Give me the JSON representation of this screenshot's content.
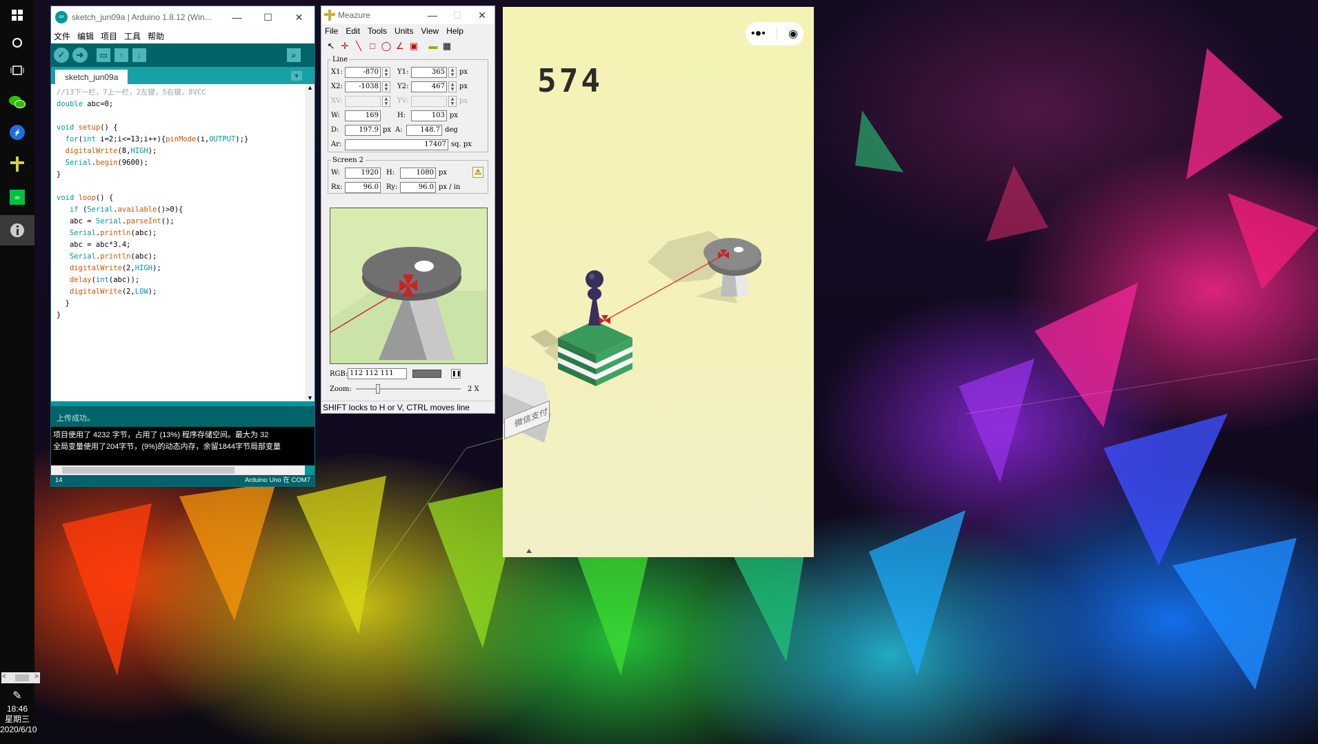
{
  "taskbar": {
    "start_icon": "windows-logo-icon",
    "items": [
      {
        "name": "cortana-icon"
      },
      {
        "name": "task-view-icon"
      },
      {
        "name": "wechat-icon"
      },
      {
        "name": "feishu-icon"
      },
      {
        "name": "meazure-icon"
      },
      {
        "name": "arduino-icon"
      },
      {
        "name": "info-icon"
      }
    ],
    "pen_icon": "pen-icon",
    "time": "18:46",
    "weekday": "星期三",
    "date": "2020/6/10"
  },
  "arduino": {
    "title": "sketch_jun09a | Arduino 1.8.12 (Win...",
    "menu": [
      "文件",
      "编辑",
      "项目",
      "工具",
      "帮助"
    ],
    "tab": "sketch_jun09a",
    "code": [
      "//13下一栏，7上一栏，2左键，5右键，8VCC",
      "double abc=0;",
      "",
      "void setup() {",
      "  for(int i=2;i<=13;i++){pinMode(i,OUTPUT);}",
      "  digitalWrite(8,HIGH);",
      "  Serial.begin(9600);",
      "}",
      "",
      "void loop() {",
      "   if (Serial.available()>0){",
      "   abc = Serial.parseInt();",
      "   Serial.println(abc);",
      "   abc = abc*3.4;",
      "   Serial.println(abc);",
      "   digitalWrite(2,HIGH);",
      "   delay(int(abc));",
      "   digitalWrite(2,LOW);",
      "  }",
      "}"
    ],
    "status": "上传成功。",
    "console": [
      "项目使用了 4232 字节，占用了 (13%) 程序存储空间。最大为 32",
      "全局变量使用了204字节，(9%)的动态内存，余留1844字节局部变量"
    ],
    "line_number": "14",
    "board": "Arduino Uno 在 COM7"
  },
  "meazure": {
    "title": "Meazure",
    "menu": [
      "File",
      "Edit",
      "Tools",
      "Units",
      "View",
      "Help"
    ],
    "line": {
      "legend": "Line",
      "x1_label": "X1:",
      "x1": "-870",
      "y1_label": "Y1:",
      "y1": "365",
      "x2_label": "X2:",
      "x2": "-1038",
      "y2_label": "Y2:",
      "y2": "467",
      "xv_label": "XV:",
      "yv_label": "YV:",
      "w_label": "W:",
      "w": "169",
      "h_label": "H:",
      "h": "103",
      "d_label": "D:",
      "d": "197.9",
      "a_label": "A:",
      "a": "148.7",
      "ar_label": "Ar:",
      "ar": "17407",
      "unit_px": "px",
      "unit_deg": "deg",
      "unit_sqpx": "sq. px"
    },
    "screen": {
      "legend": "Screen 2",
      "w_label": "W:",
      "w": "1920",
      "h_label": "H:",
      "h": "1080",
      "rx_label": "Rx:",
      "rx": "96.0",
      "ry_label": "Ry:",
      "ry": "96.0",
      "unit_px": "px",
      "unit_res": "px / in"
    },
    "rgb_label": "RGB:",
    "rgb": "112 112 111",
    "zoom_label": "Zoom:",
    "zoom": "2 X",
    "zoom_level": 0.2,
    "status": "SHIFT locks to H or V, CTRL moves line"
  },
  "game": {
    "score": "574",
    "menu_icon": "more-dots-icon",
    "close_icon": "target-close-icon",
    "sign_text": "微信支付"
  },
  "colors": {
    "arduino_teal": "#00979c",
    "arduino_dark": "#006468",
    "game_bg": "#f4f3b4",
    "measure_line": "#e02020"
  }
}
